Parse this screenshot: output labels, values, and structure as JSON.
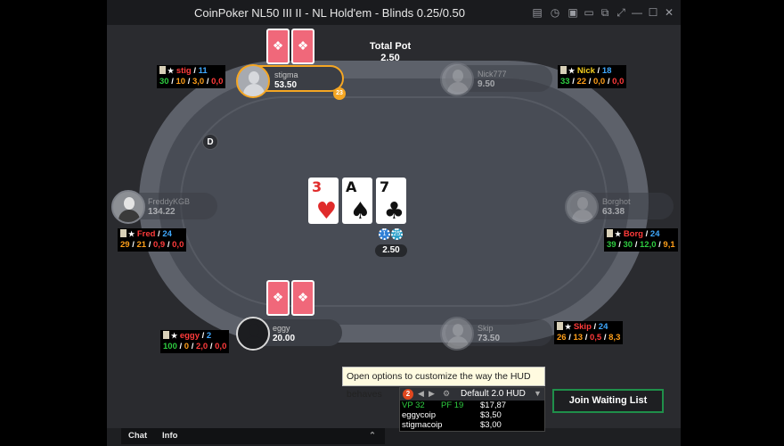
{
  "window": {
    "title": "CoinPoker NL50 III II - NL Hold'em - Blinds 0.25/0.50",
    "controls": [
      "list-icon",
      "history-icon",
      "save-icon",
      "tables-icon",
      "resize-icon",
      "minimize-icon",
      "maximize-icon",
      "close-icon"
    ]
  },
  "pot": {
    "label": "Total Pot",
    "value": "2.50"
  },
  "dealer": "D",
  "board": [
    {
      "rank": "3",
      "suit": "♥",
      "color": "#e02b2b"
    },
    {
      "rank": "A",
      "suit": "♠",
      "color": "#111111"
    },
    {
      "rank": "7",
      "suit": "♣",
      "color": "#111111"
    }
  ],
  "bet": {
    "chips": [
      "1",
      "25"
    ],
    "amount": "2.50"
  },
  "seats": {
    "stigma": {
      "name": "stigma",
      "stack": "53.50",
      "timer": "23"
    },
    "nick": {
      "name": "Nick777",
      "stack": "9.50"
    },
    "fred": {
      "name": "FreddyKGB",
      "stack": "134.22"
    },
    "borg": {
      "name": "Borghot",
      "stack": "63.38"
    },
    "eggy": {
      "name": "eggy",
      "stack": "20.00"
    },
    "skip": {
      "name": "Skip",
      "stack": "73.50"
    }
  },
  "huds": {
    "stig": {
      "name": "stig",
      "hands": "11",
      "s1": "30",
      "s2": "10",
      "s3": "3,0",
      "s4": "0,0"
    },
    "nick": {
      "name": "Nick",
      "hands": "18",
      "s1": "33",
      "s2": "22",
      "s3": "0,0",
      "s4": "0,0"
    },
    "fred": {
      "name": "Fred",
      "hands": "24",
      "s1": "29",
      "s2": "21",
      "s3": "0,9",
      "s4": "0,0"
    },
    "borg": {
      "name": "Borg",
      "hands": "24",
      "s1": "39",
      "s2": "30",
      "s3": "12,0",
      "s4": "9,1"
    },
    "eggy": {
      "name": "eggy",
      "hands": "2",
      "s1": "100",
      "s2": "0",
      "s3": "2,0",
      "s4": "0,0"
    },
    "skip": {
      "name": "Skip",
      "hands": "24",
      "s1": "26",
      "s2": "13",
      "s3": "0,5",
      "s4": "8,3"
    }
  },
  "tooltip": "Open options to customize the way the HUD behaves",
  "hud_panel": {
    "badge": "2",
    "profile": "Default 2.0 HUD",
    "vp": "VP 32",
    "pf": "PF 19",
    "total": "$17,87",
    "rows": [
      {
        "name": "eggycoip",
        "value": "$3,50"
      },
      {
        "name": "stigmacoip",
        "value": "$3,00"
      }
    ]
  },
  "join_button": "Join Waiting List",
  "bottom_tabs": [
    "Chat",
    "Info"
  ]
}
